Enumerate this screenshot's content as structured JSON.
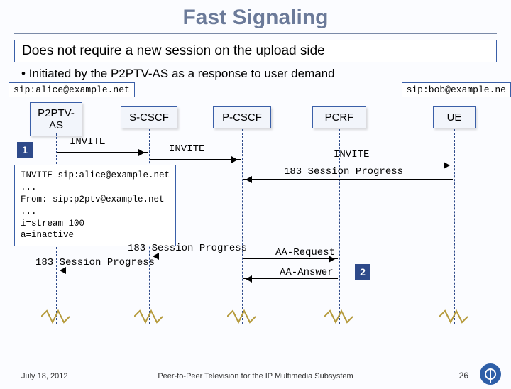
{
  "title": "Fast Signaling",
  "banner": "Does not require a new session on the upload side",
  "bullet": "•   Initiated by the P2PTV-AS as a response to user demand",
  "sip_alice": "sip:alice@example.net",
  "sip_bob": "sip:bob@example.ne",
  "nodes": {
    "p2ptv": "P2PTV-\nAS",
    "scscf": "S-CSCF",
    "pcscf": "P-CSCF",
    "pcrf": "PCRF",
    "ue": "UE"
  },
  "badges": {
    "one": "1",
    "two": "2"
  },
  "msgs": {
    "invite": "INVITE",
    "sp183": "183 Session Progress",
    "aareq": "AA-Request",
    "aaans": "AA-Answer"
  },
  "invite_box": "INVITE sip:alice@example.net\n...\nFrom: sip:p2ptv@example.net\n...\ni=stream 100\na=inactive",
  "footer": {
    "date": "July 18, 2012",
    "title": "Peer-to-Peer Television for the IP Multimedia Subsystem",
    "page": "26"
  }
}
